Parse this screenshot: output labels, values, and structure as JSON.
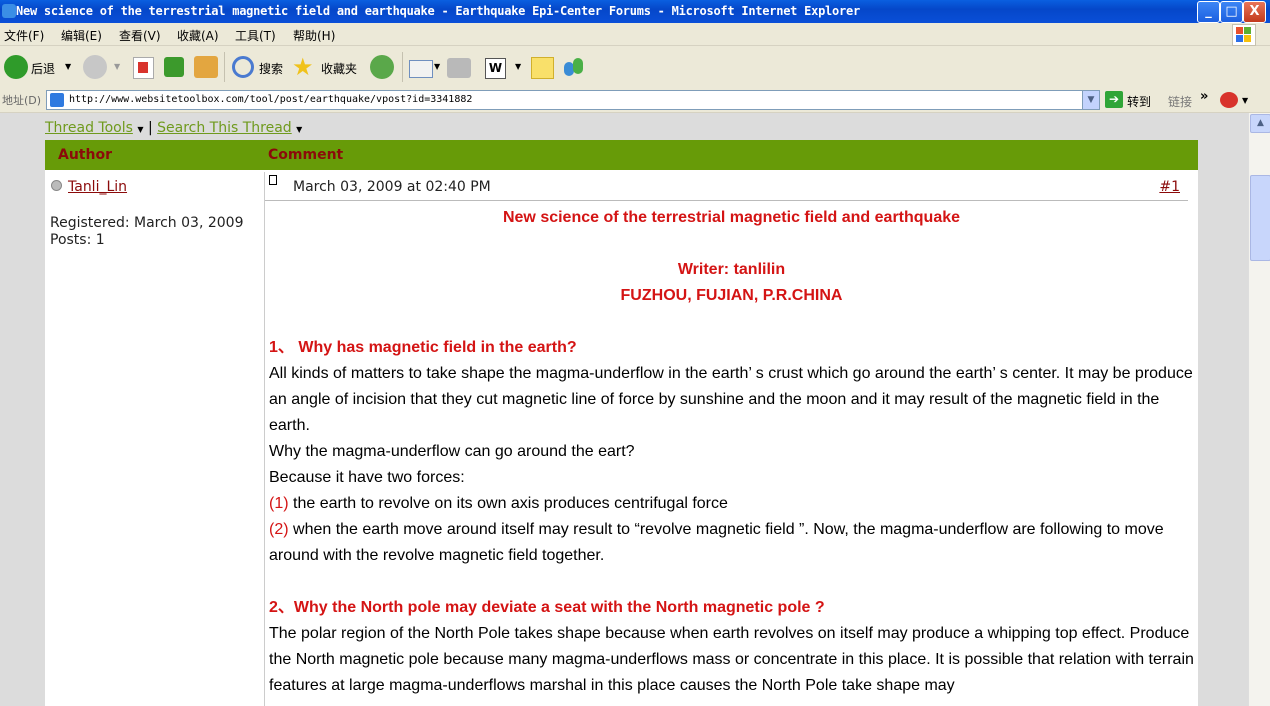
{
  "window": {
    "title": "New science of the terrestrial magnetic field and earthquake - Earthquake Epi-Center Forums - Microsoft Internet Explorer",
    "minimize": "_",
    "maximize": "□",
    "close": "X"
  },
  "menu": [
    "文件(F)",
    "编辑(E)",
    "查看(V)",
    "收藏(A)",
    "工具(T)",
    "帮助(H)"
  ],
  "toolbar": {
    "back_label": "后退",
    "search_label": "搜索",
    "favorites_label": "收藏夹"
  },
  "address": {
    "label": "地址(D)",
    "url": "http://www.websitetoolbox.com/tool/post/earthquake/vpost?id=3341882",
    "go_label": "转到",
    "links_label": "链接",
    "chevron": "»"
  },
  "thread": {
    "tools_label": "Thread Tools",
    "separator": "|",
    "search_label": "Search This Thread"
  },
  "table_header": {
    "author": "Author",
    "comment": "Comment"
  },
  "author": {
    "name": "Tanli_Lin",
    "registered": "Registered: March 03, 2009",
    "posts": "Posts: 1"
  },
  "post": {
    "date": "March 03, 2009 at 02:40 PM",
    "number": "#1",
    "title": "New science of the terrestrial magnetic field and earthquake",
    "writer": "Writer: tanlilin",
    "location": "FUZHOU, FUJIAN, P.R.CHINA",
    "q1_heading": "1、 Why has magnetic field in the earth?",
    "q1_p1": "All kinds of matters to take shape the magma-underflow in the earth’ s crust which go around the earth’ s center. It may be produce an angle of incision that they cut magnetic line of force by sunshine and the moon and it may result of the magnetic field in the earth.",
    "q1_p2": "Why the magma-underflow can go around the eart?",
    "q1_p3": "Because it have two forces:",
    "f1_num": "(1)",
    "f1_text": " the earth to revolve on its own axis produces centrifugal force",
    "f2_num": "(2)",
    "f2_text": " when the earth move around itself may result to “revolve magnetic field ”. Now, the magma-underflow are following to move around with the revolve magnetic field together.",
    "q2_heading": "2、Why the North pole may deviate a seat with the North magnetic pole ?",
    "q2_p1": "The polar region of the North Pole takes shape because when earth revolves on itself may produce a whipping top effect. Produce the North magnetic pole because many magma-underflows mass or concentrate in this place. It is possible that relation with terrain features at large magma-underflows marshal in this place causes the North Pole take shape may"
  }
}
